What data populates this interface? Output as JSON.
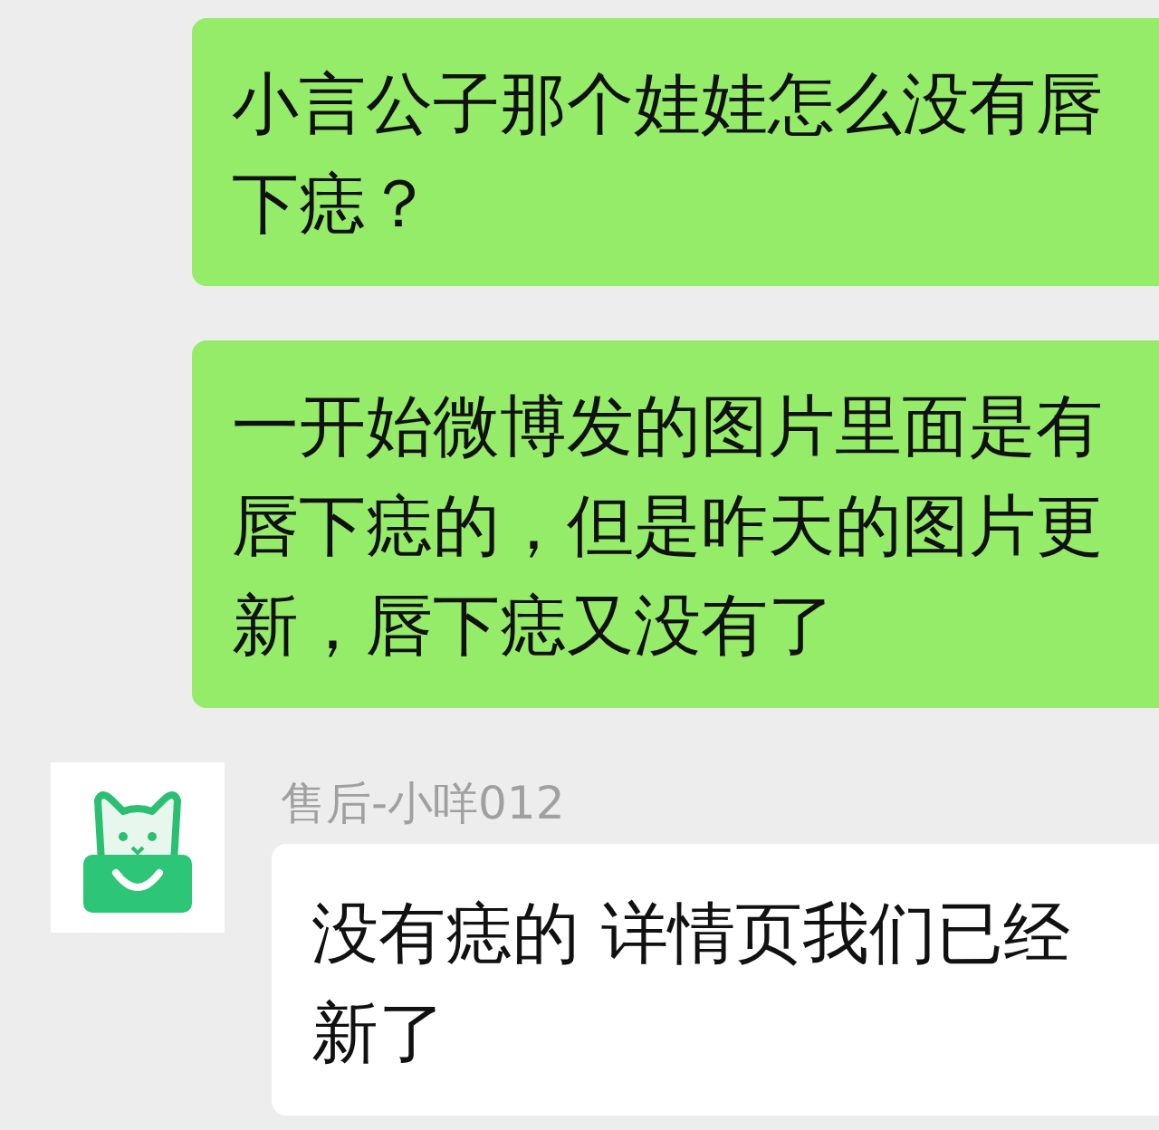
{
  "messages": [
    {
      "kind": "sent",
      "lines": [
        "小言公子那个娃娃怎么没有唇",
        "下痣？"
      ]
    },
    {
      "kind": "sent",
      "lines": [
        "一开始微博发的图片里面是有",
        "唇下痣的，但是昨天的图片更",
        "新，唇下痣又没有了"
      ]
    },
    {
      "kind": "received",
      "sender": "售后-小咩012",
      "lines": [
        "没有痣的 详情页我们已经",
        "新了"
      ]
    }
  ]
}
